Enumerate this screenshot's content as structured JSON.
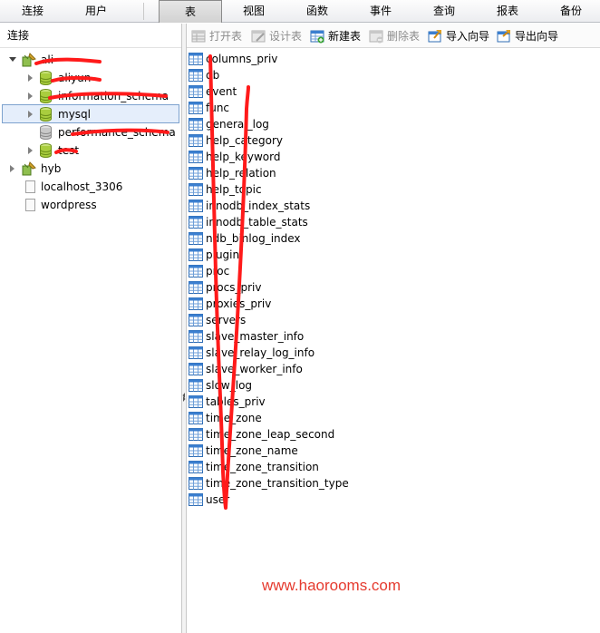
{
  "menu": {
    "items": [
      "连接",
      "用户",
      "表",
      "视图",
      "函数",
      "事件",
      "查询",
      "报表",
      "备份"
    ],
    "active": "表"
  },
  "left_pane": {
    "header": "连接",
    "tree": [
      {
        "label": "ali",
        "kind": "connection",
        "expanded": true
      },
      {
        "label": "aliyun",
        "kind": "database"
      },
      {
        "label": "information_schema",
        "kind": "database"
      },
      {
        "label": "mysql",
        "kind": "database",
        "selected": true
      },
      {
        "label": "performance_schema",
        "kind": "database"
      },
      {
        "label": "test",
        "kind": "database"
      },
      {
        "label": "hyb",
        "kind": "connection",
        "expanded": false
      },
      {
        "label": "localhost_3306",
        "kind": "connection-closed"
      },
      {
        "label": "wordpress",
        "kind": "connection-closed"
      }
    ]
  },
  "toolbar": {
    "buttons": [
      {
        "label": "打开表",
        "icon": "open-table-icon",
        "enabled": false
      },
      {
        "label": "设计表",
        "icon": "design-table-icon",
        "enabled": false
      },
      {
        "label": "新建表",
        "icon": "new-table-icon",
        "enabled": true
      },
      {
        "label": "删除表",
        "icon": "delete-table-icon",
        "enabled": false
      },
      {
        "label": "导入向导",
        "icon": "import-wizard-icon",
        "enabled": true
      },
      {
        "label": "导出向导",
        "icon": "export-wizard-icon",
        "enabled": true
      }
    ]
  },
  "tables": [
    "columns_priv",
    "db",
    "event",
    "func",
    "general_log",
    "help_category",
    "help_keyword",
    "help_relation",
    "help_topic",
    "innodb_index_stats",
    "innodb_table_stats",
    "ndb_binlog_index",
    "plugin",
    "proc",
    "procs_priv",
    "proxies_priv",
    "servers",
    "slave_master_info",
    "slave_relay_log_info",
    "slave_worker_info",
    "slow_log",
    "tables_priv",
    "time_zone",
    "time_zone_leap_second",
    "time_zone_name",
    "time_zone_transition",
    "time_zone_transition_type",
    "user"
  ],
  "watermark": "www.haorooms.com",
  "colors": {
    "annotation_red": "#ff1a1a",
    "watermark_red": "#e53a2e",
    "selection_bg": "#e5eefb",
    "selection_border": "#7da2ce"
  }
}
